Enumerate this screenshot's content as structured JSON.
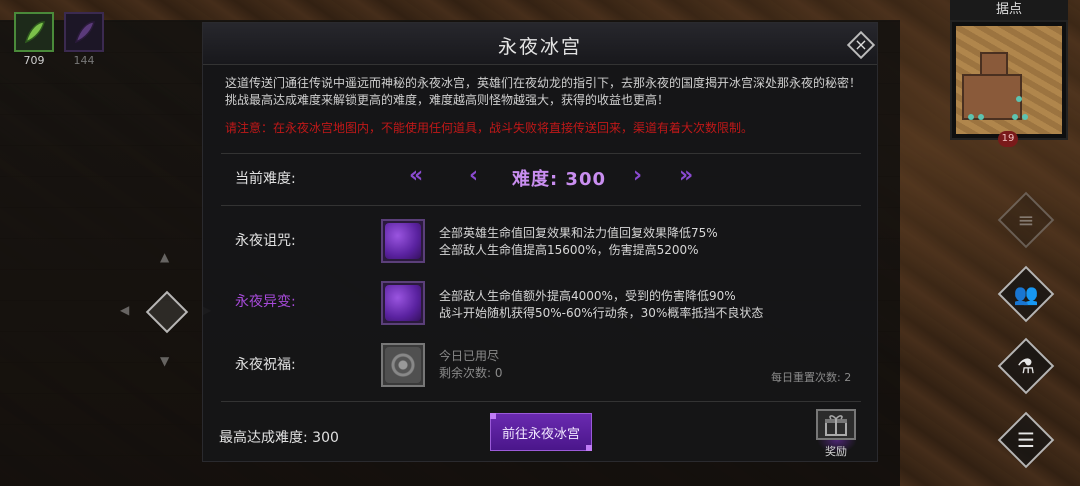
{
  "items": [
    {
      "icon": "green-feather-icon",
      "count": "709"
    },
    {
      "icon": "purple-feather-icon",
      "count": "144"
    }
  ],
  "minimap": {
    "title": "据点",
    "badge": "19"
  },
  "side_buttons": [
    {
      "icon": "scroll-icon",
      "glyph": "≡"
    },
    {
      "icon": "party-icon",
      "glyph": "👥"
    },
    {
      "icon": "potion-icon",
      "glyph": "⚗"
    },
    {
      "icon": "menu-list-icon",
      "glyph": "☰"
    }
  ],
  "modal": {
    "title": "永夜冰宫",
    "close_glyph": "×",
    "description": "这道传送门通往传说中遥远而神秘的永夜冰宫，英雄们在夜幼龙的指引下，去那永夜的国度揭开冰宫深处那永夜的秘密！挑战最高达成难度来解锁更高的难度，难度越高则怪物越强大，获得的收益也更高！",
    "warning": "请注意：在永夜冰宫地图内，不能使用任何道具，战斗失败将直接传送回来，渠道有着大次数限制。",
    "difficulty": {
      "label": "当前难度:",
      "value": "难度: 300",
      "fast_prev": "«",
      "prev": "‹",
      "next": "›",
      "fast_next": "»"
    },
    "curse": {
      "label": "永夜诅咒:",
      "lines": [
        "全部英雄生命值回复效果和法力值回复效果降低75%",
        "全部敌人生命值提高15600%，伤害提高5200%"
      ]
    },
    "mutation": {
      "label": "永夜异变:",
      "lines": [
        "全部敌人生命值额外提高4000%，受到的伤害降低90%",
        "战斗开始随机获得50%-60%行动条，30%概率抵挡不良状态"
      ]
    },
    "blessing": {
      "label": "永夜祝福:",
      "lines": [
        "今日已用尽",
        "剩余次数: 0"
      ],
      "reset": "每日重置次数: 2"
    },
    "best": "最高达成难度: 300",
    "go_button": "前往永夜冰宫",
    "reward_label": "奖励"
  },
  "colors": {
    "accent_purple": "#8a4ad0",
    "warning_red": "#c01818",
    "mutation_label": "#a64ad8"
  }
}
